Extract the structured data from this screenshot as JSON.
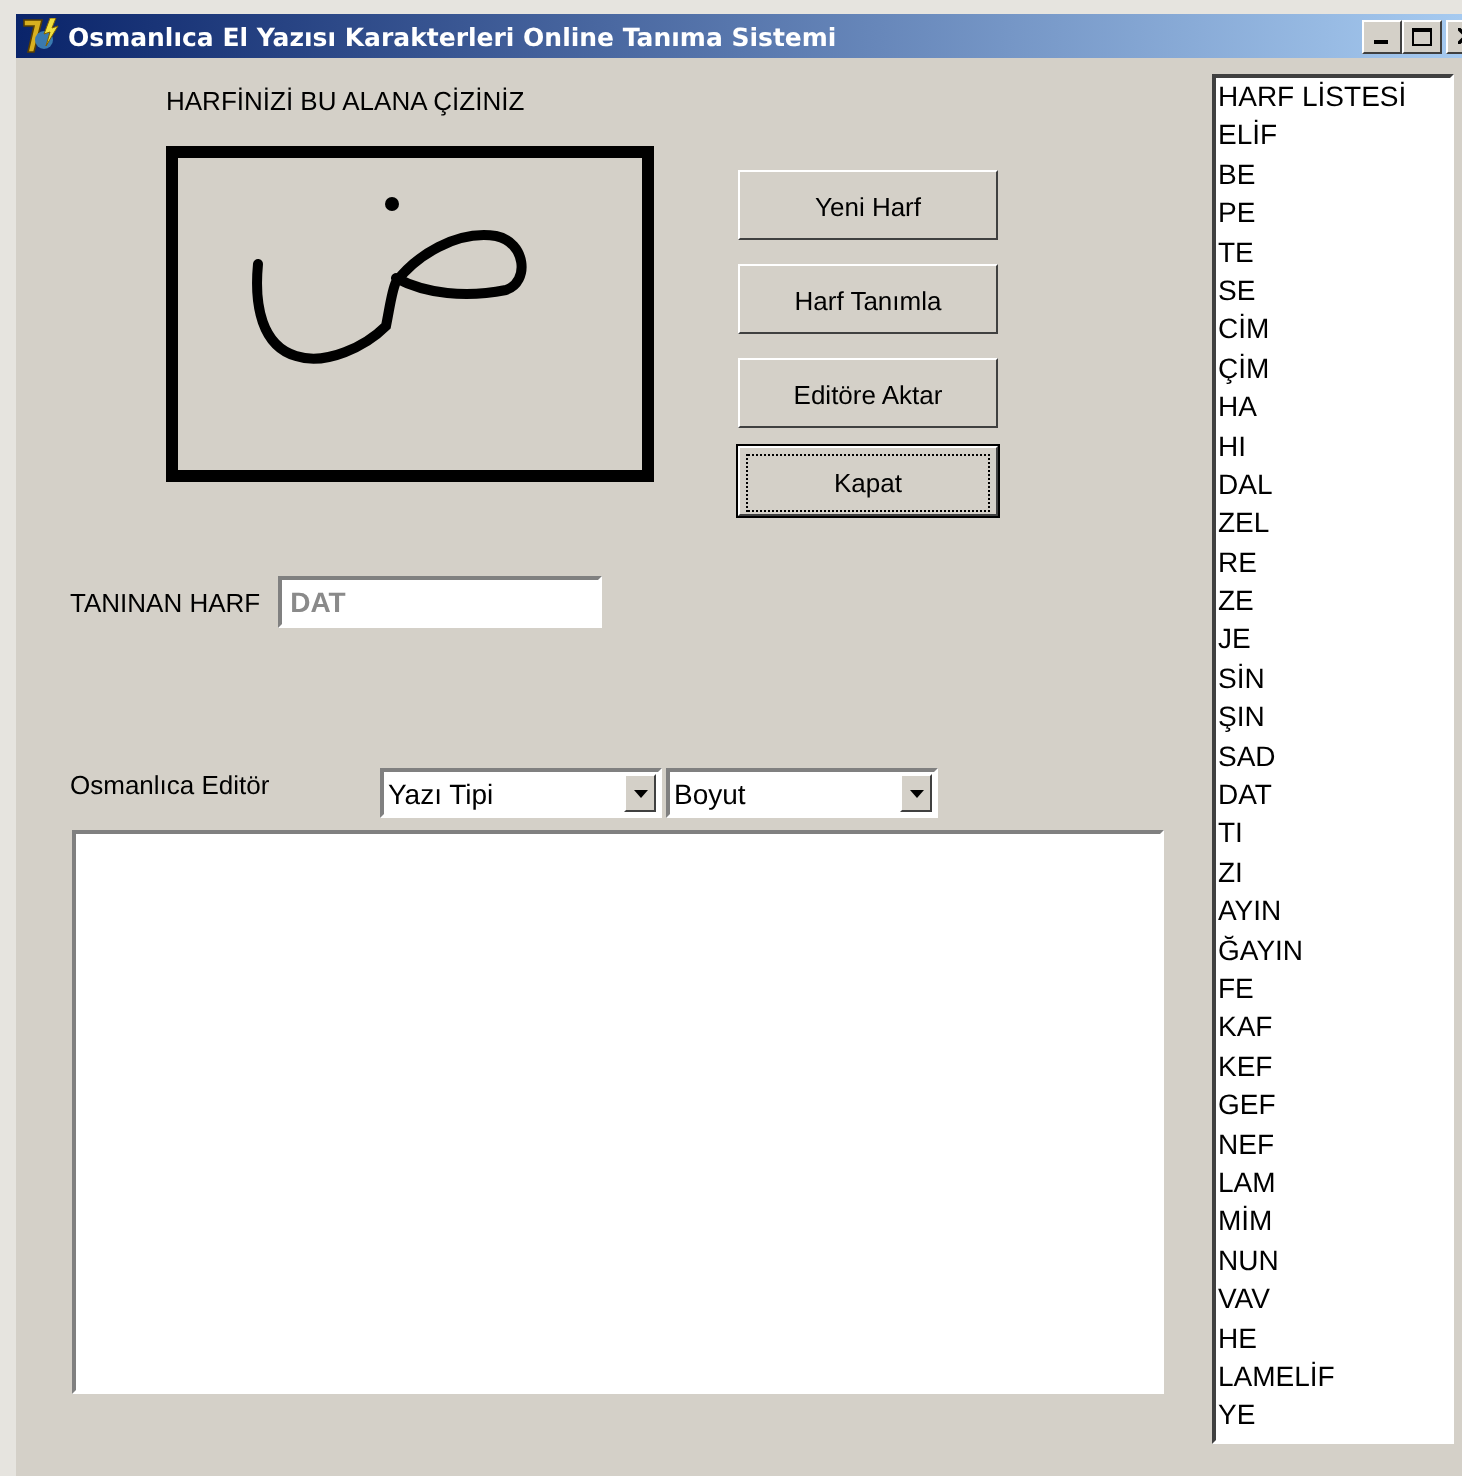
{
  "window": {
    "title": "Osmanlıca El Yazısı Karakterleri Online Tanıma Sistemi"
  },
  "draw_area": {
    "label": "HARFİNİZİ BU ALANA ÇİZİNİZ"
  },
  "buttons": [
    {
      "label": "Yeni Harf",
      "default": false
    },
    {
      "label": "Harf Tanımla",
      "default": false
    },
    {
      "label": "Editöre Aktar",
      "default": false
    },
    {
      "label": "Kapat",
      "default": true
    }
  ],
  "recognized": {
    "label": "TANINAN HARF",
    "value": "DAT",
    "disabled": true
  },
  "editor": {
    "label": "Osmanlıca Editör",
    "font_select": {
      "value": "Yazı Tipi"
    },
    "size_select": {
      "value": "Boyut"
    }
  },
  "letter_list": [
    "HARF LİSTESİ",
    "ELİF",
    "BE",
    "PE",
    "TE",
    "SE",
    "CİM",
    "ÇİM",
    "HA",
    "HI",
    "DAL",
    "ZEL",
    "RE",
    "ZE",
    "JE",
    "SİN",
    "ŞIN",
    "SAD",
    "DAT",
    "TI",
    "ZI",
    "AYIN",
    "ĞAYIN",
    "FE",
    "KAF",
    "KEF",
    "GEF",
    "NEF",
    "LAM",
    "MİM",
    "NUN",
    "VAV",
    "HE",
    "LAMELİF",
    "YE"
  ]
}
